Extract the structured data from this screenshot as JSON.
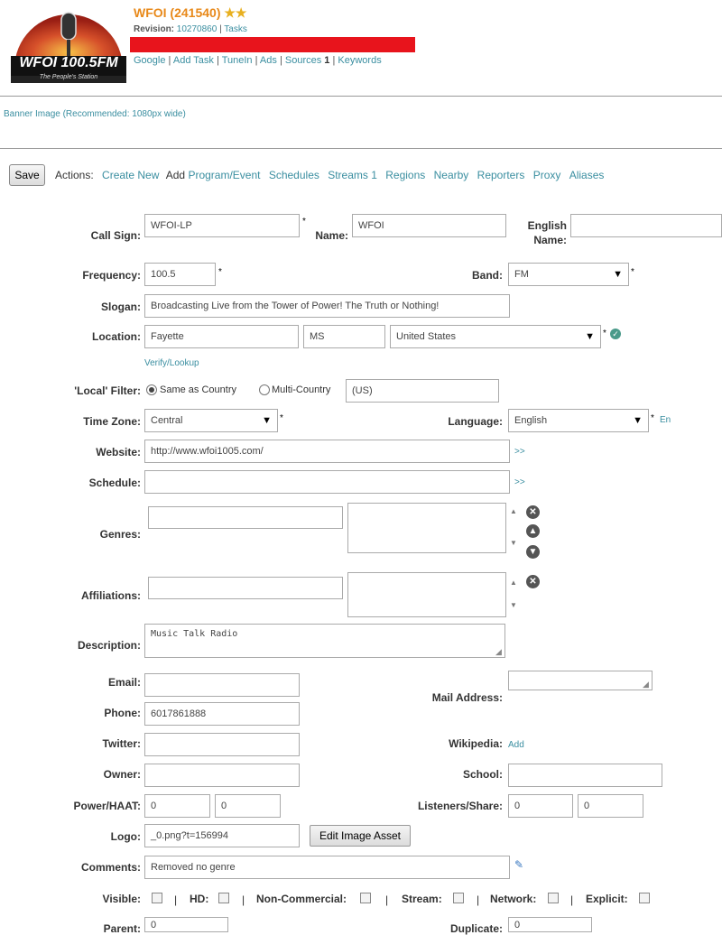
{
  "header": {
    "logo_text": "WFOI 100.5FM",
    "logo_tagline": "The People's Station",
    "title": "WFOI (241540)",
    "stars": "★★",
    "revision_label": "Revision:",
    "revision_value": "10270860",
    "tasks_link": "Tasks",
    "links": [
      "Google",
      "Add Task",
      "TuneIn",
      "Ads",
      "Sources",
      "Keywords"
    ],
    "sources_count": "1",
    "banner_text": "Banner Image (Recommended: 1080px wide)"
  },
  "toolbar": {
    "save_label": "Save",
    "actions_label": "Actions:",
    "create_new": "Create New",
    "add_label": "Add",
    "program_event": "Program/Event",
    "schedules": "Schedules",
    "streams": "Streams 1",
    "regions": "Regions",
    "nearby": "Nearby",
    "reporters": "Reporters",
    "proxy": "Proxy",
    "aliases": "Aliases"
  },
  "form": {
    "call_sign_label": "Call Sign:",
    "call_sign_value": "WFOI-LP",
    "name_label": "Name:",
    "name_value": "WFOI",
    "english_name_label": "English Name:",
    "frequency_label": "Frequency:",
    "frequency_value": "100.5",
    "band_label": "Band:",
    "band_value": "FM",
    "slogan_label": "Slogan:",
    "slogan_value": "Broadcasting Live from the Tower of Power! The Truth or Nothing!",
    "location_label": "Location:",
    "city_value": "Fayette",
    "state_value": "MS",
    "country_value": "United States",
    "verify_link": "Verify/Lookup",
    "local_filter_label": "'Local' Filter:",
    "same_as_country": "Same as Country",
    "multi_country": "Multi-Country",
    "filter_value": "(US)",
    "timezone_label": "Time Zone:",
    "timezone_value": "Central",
    "language_label": "Language:",
    "language_value": "English",
    "language_code": "En",
    "website_label": "Website:",
    "website_value": "http://www.wfoi1005.com/",
    "schedule_label": "Schedule:",
    "more_link": ">>",
    "genres_label": "Genres:",
    "affiliations_label": "Affiliations:",
    "description_label": "Description:",
    "description_value": "Music Talk Radio",
    "email_label": "Email:",
    "mail_address_label": "Mail Address:",
    "phone_label": "Phone:",
    "phone_value": "6017861888",
    "twitter_label": "Twitter:",
    "wikipedia_label": "Wikipedia:",
    "wikipedia_add": "Add",
    "owner_label": "Owner:",
    "school_label": "School:",
    "power_label": "Power/HAAT:",
    "power_value": "0",
    "haat_value": "0",
    "listeners_label": "Listeners/Share:",
    "listeners_value": "0",
    "share_value": "0",
    "logo_label": "Logo:",
    "logo_value": "_0.png?t=156994",
    "edit_image_button": "Edit Image Asset",
    "comments_label": "Comments:",
    "comments_value": "Removed no genre",
    "visible_label": "Visible:",
    "hd_label": "HD:",
    "noncommercial_label": "Non-Commercial:",
    "stream_label": "Stream:",
    "network_label": "Network:",
    "explicit_label": "Explicit:",
    "separator": "|",
    "parent_label": "Parent:",
    "parent_value": "0",
    "duplicate_label": "Duplicate:",
    "duplicate_value": "0"
  },
  "colors": {
    "link": "#3a8ea0",
    "title": "#e8891a",
    "redaction": "#e8141c"
  }
}
